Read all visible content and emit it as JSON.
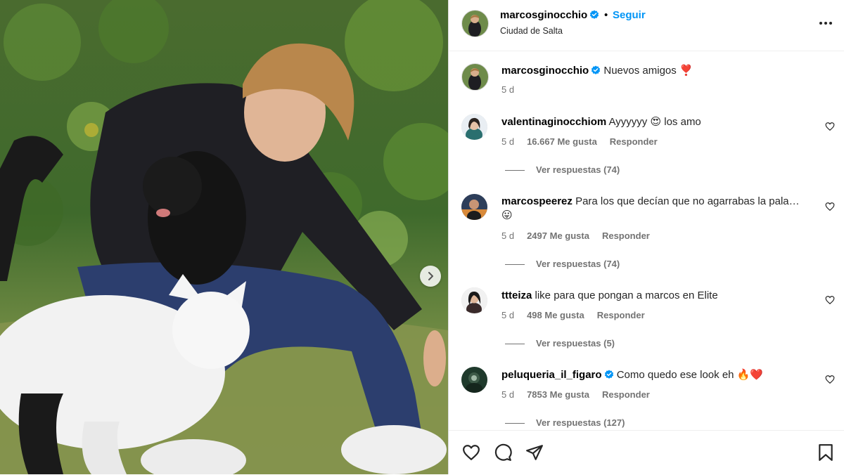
{
  "post": {
    "username": "marcosginocchio",
    "separator": "•",
    "follow_label": "Seguir",
    "location": "Ciudad de Salta",
    "caption_text": "Nuevos amigos",
    "caption_emoji": "❣️",
    "caption_time": "5 d"
  },
  "comments": [
    {
      "username": "valentinaginocchiom",
      "text": "Ayyyyyy 😍 los amo",
      "time": "5 d",
      "likes": "16.667 Me gusta",
      "reply_label": "Responder",
      "view_replies": "Ver respuestas (74)"
    },
    {
      "username": "marcospeerez",
      "text": "Para los que decían que no agarrabas la pala…",
      "text2": "😛",
      "time": "5 d",
      "likes": "2497 Me gusta",
      "reply_label": "Responder",
      "view_replies": "Ver respuestas (74)"
    },
    {
      "username": "ttteiza",
      "text": "like para que pongan a marcos en Elite",
      "time": "5 d",
      "likes": "498 Me gusta",
      "reply_label": "Responder",
      "view_replies": "Ver respuestas (5)"
    },
    {
      "username": "peluqueria_il_figaro",
      "text": "Como quedo ese look eh 🔥❤️",
      "time": "5 d",
      "likes": "7853 Me gusta",
      "reply_label": "Responder",
      "view_replies": "Ver respuestas (127)"
    }
  ],
  "icons": {
    "more": "more-options-icon",
    "like": "heart-icon",
    "comment": "comment-icon",
    "share": "share-icon",
    "save": "bookmark-icon",
    "verified": "verified-badge-icon",
    "next": "chevron-right-icon"
  },
  "colors": {
    "accent": "#0095f6",
    "muted": "#737373",
    "verified": "#0095f6"
  }
}
